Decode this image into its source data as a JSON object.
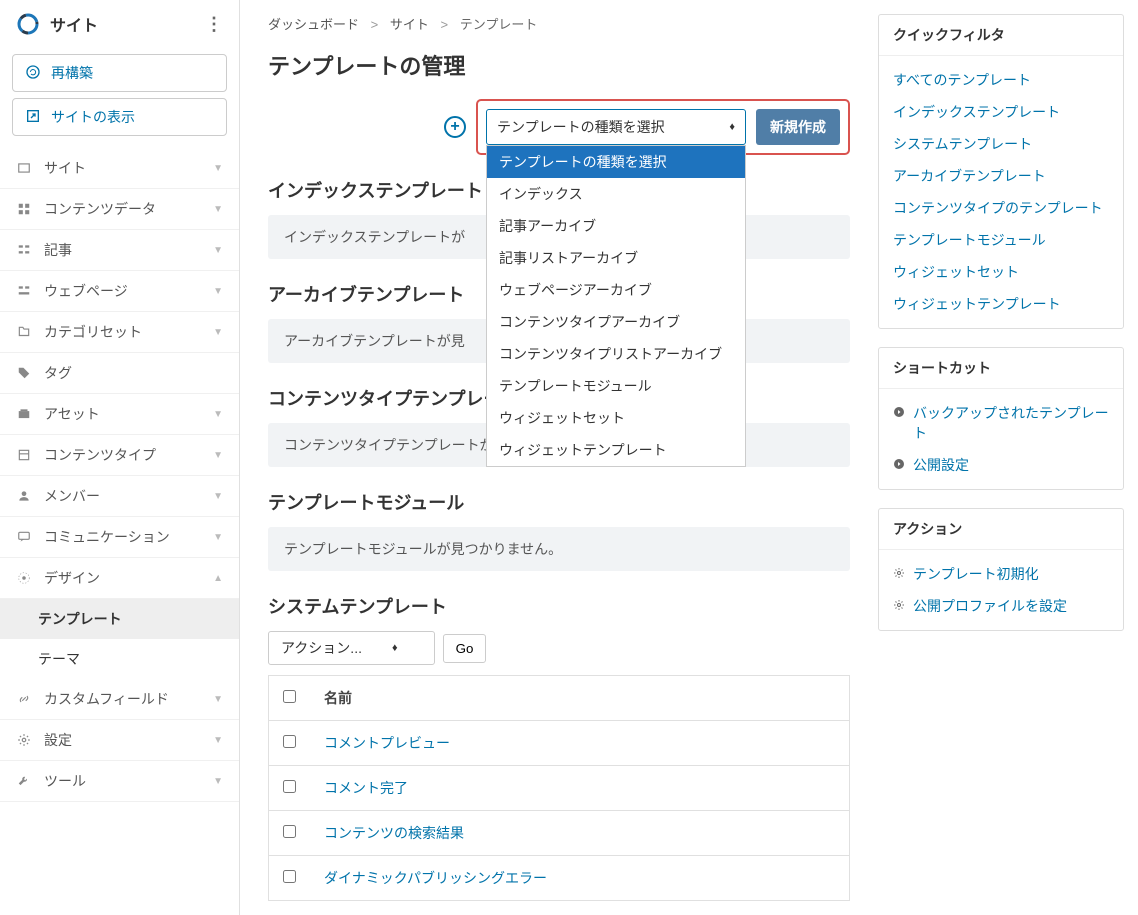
{
  "sidebar": {
    "title": "サイト",
    "rebuild": "再構築",
    "viewSite": "サイトの表示",
    "items": [
      {
        "label": "サイト"
      },
      {
        "label": "コンテンツデータ"
      },
      {
        "label": "記事"
      },
      {
        "label": "ウェブページ"
      },
      {
        "label": "カテゴリセット"
      },
      {
        "label": "タグ"
      },
      {
        "label": "アセット"
      },
      {
        "label": "コンテンツタイプ"
      },
      {
        "label": "メンバー"
      },
      {
        "label": "コミュニケーション"
      },
      {
        "label": "デザイン"
      },
      {
        "label": "カスタムフィールド"
      },
      {
        "label": "設定"
      },
      {
        "label": "ツール"
      }
    ],
    "designSub": [
      {
        "label": "テンプレート",
        "active": true
      },
      {
        "label": "テーマ",
        "active": false
      }
    ]
  },
  "breadcrumb": {
    "dashboard": "ダッシュボード",
    "site": "サイト",
    "template": "テンプレート"
  },
  "pageTitle": "テンプレートの管理",
  "toolbar": {
    "selectLabel": "テンプレートの種類を選択",
    "createBtn": "新規作成"
  },
  "dropdownOptions": [
    "テンプレートの種類を選択",
    "インデックス",
    "記事アーカイブ",
    "記事リストアーカイブ",
    "ウェブページアーカイブ",
    "コンテンツタイプアーカイブ",
    "コンテンツタイプリストアーカイブ",
    "テンプレートモジュール",
    "ウィジェットセット",
    "ウィジェットテンプレート"
  ],
  "sections": {
    "index": {
      "title": "インデックステンプレート",
      "empty": "インデックステンプレートが"
    },
    "archive": {
      "title": "アーカイブテンプレート",
      "empty": "アーカイブテンプレートが見"
    },
    "contentType": {
      "title": "コンテンツタイプテンプレート",
      "empty": "コンテンツタイプテンプレートが見つかりません。"
    },
    "module": {
      "title": "テンプレートモジュール",
      "empty": "テンプレートモジュールが見つかりません。"
    },
    "system": {
      "title": "システムテンプレート"
    }
  },
  "actionSelect": "アクション...",
  "goBtn": "Go",
  "table": {
    "header": {
      "name": "名前"
    },
    "rows": [
      {
        "name": "コメントプレビュー"
      },
      {
        "name": "コメント完了"
      },
      {
        "name": "コンテンツの検索結果"
      },
      {
        "name": "ダイナミックパブリッシングエラー"
      }
    ]
  },
  "quickFilter": {
    "title": "クイックフィルタ",
    "links": [
      "すべてのテンプレート",
      "インデックステンプレート",
      "システムテンプレート",
      "アーカイブテンプレート",
      "コンテンツタイプのテンプレート",
      "テンプレートモジュール",
      "ウィジェットセット",
      "ウィジェットテンプレート"
    ]
  },
  "shortcuts": {
    "title": "ショートカット",
    "links": [
      "バックアップされたテンプレート",
      "公開設定"
    ]
  },
  "actionsPanel": {
    "title": "アクション",
    "links": [
      "テンプレート初期化",
      "公開プロファイルを設定"
    ]
  }
}
